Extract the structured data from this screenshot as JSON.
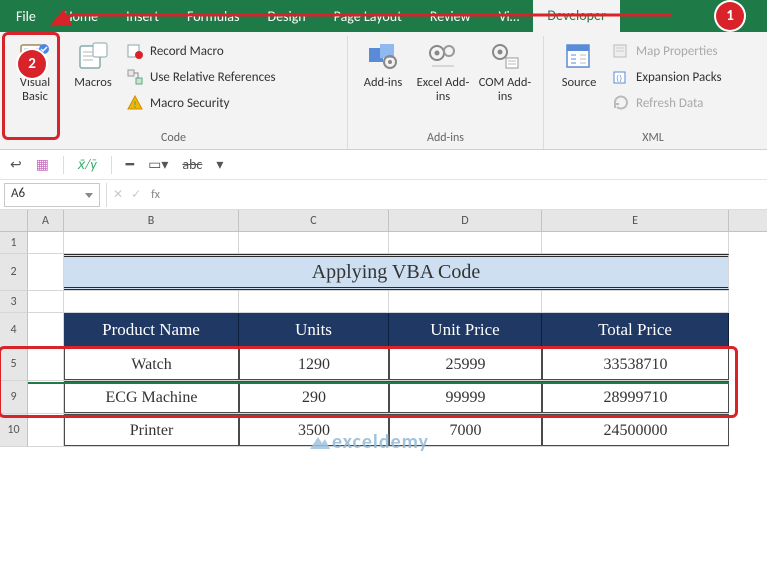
{
  "tabs": [
    "File",
    "Home",
    "Insert",
    "Formulas",
    "Design",
    "Page Layout",
    "Review",
    "Vi…",
    "Developer"
  ],
  "active_tab_index": 8,
  "callouts": {
    "one": "1",
    "two": "2"
  },
  "ribbon": {
    "code": {
      "label": "Code",
      "visual_basic": "Visual Basic",
      "macros": "Macros",
      "record_macro": "Record Macro",
      "use_relative": "Use Relative References",
      "macro_security": "Macro Security"
    },
    "addins": {
      "label": "Add-ins",
      "addins": "Add-ins",
      "excel_addins": "Excel Add-ins",
      "com_addins": "COM Add-ins"
    },
    "xml": {
      "label": "XML",
      "source": "Source",
      "map_properties": "Map Properties",
      "expansion_packs": "Expansion Packs",
      "refresh_data": "Refresh Data"
    }
  },
  "namebox": "A6",
  "fx_label": "fx",
  "columns": [
    "A",
    "B",
    "C",
    "D",
    "E"
  ],
  "row_labels": [
    "1",
    "2",
    "3",
    "4",
    "5",
    "9",
    "10"
  ],
  "title_cell": "Applying VBA Code",
  "headers": [
    "Product Name",
    "Units",
    "Unit Price",
    "Total Price"
  ],
  "data": [
    {
      "name": "Watch",
      "units": "1290",
      "price": "25999",
      "total": "33538710"
    },
    {
      "name": "ECG Machine",
      "units": "290",
      "price": "99999",
      "total": "28999710"
    },
    {
      "name": "Printer",
      "units": "3500",
      "price": "7000",
      "total": "24500000"
    }
  ],
  "watermark": "exceldemy",
  "colors": {
    "accent": "#1e7a46",
    "callout": "#d8232a",
    "th_bg": "#1f3864",
    "title_bg": "#cddff0"
  }
}
